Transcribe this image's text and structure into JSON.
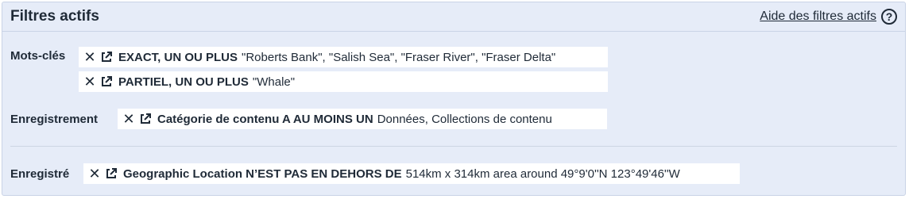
{
  "header": {
    "title": "Filtres actifs",
    "help_label": "Aide des filtres actifs",
    "help_icon": "question-circle-icon"
  },
  "groups": {
    "keywords": {
      "label": "Mots-clés",
      "filters": [
        {
          "operator": "EXACT, UN OU PLUS",
          "value": "\"Roberts Bank\", \"Salish Sea\", \"Fraser River\", \"Fraser Delta\""
        },
        {
          "operator": "PARTIEL, UN OU PLUS",
          "value": "\"Whale\""
        }
      ]
    },
    "record": {
      "label": "Enregistrement",
      "filters": [
        {
          "operator": "Catégorie de contenu A AU MOINS UN",
          "value": "Données, Collections de contenu"
        }
      ]
    },
    "registered": {
      "label": "Enregistré",
      "filters": [
        {
          "operator": "Geographic Location N’EST PAS EN DEHORS DE",
          "value": "514km x 314km area around 49°9'0''N 123°49'46''W"
        }
      ]
    }
  },
  "icons": {
    "remove": "close-icon",
    "open": "external-link-icon"
  }
}
